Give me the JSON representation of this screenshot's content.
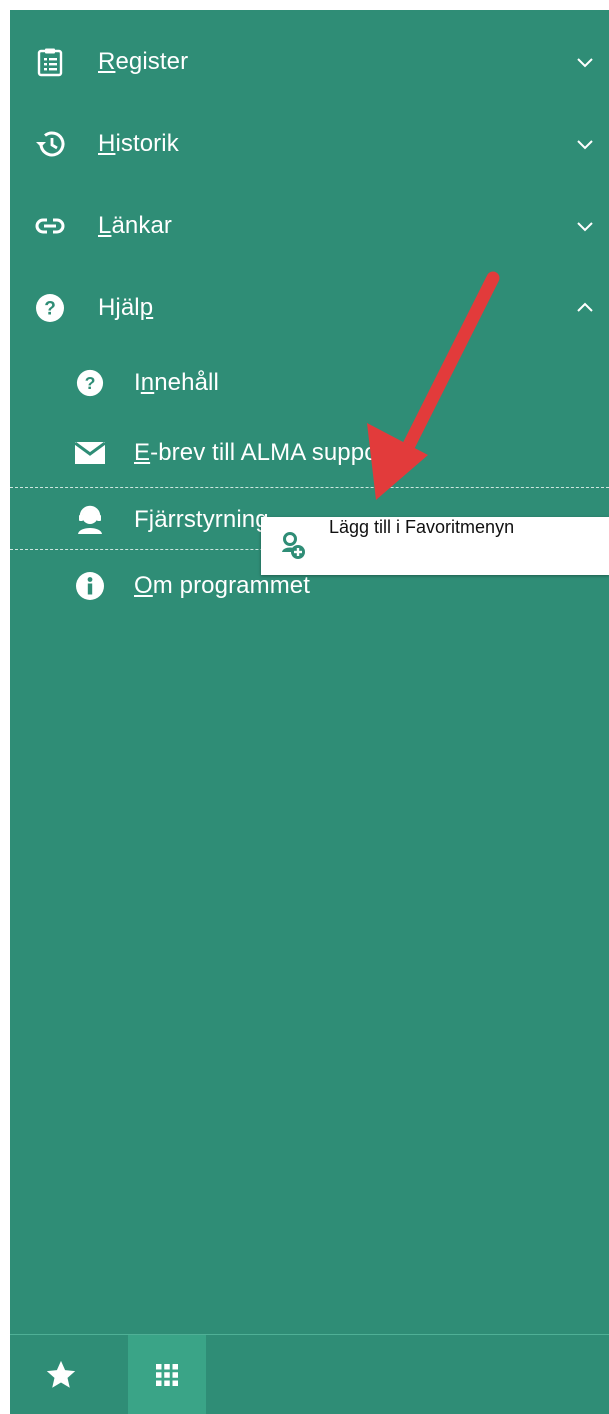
{
  "menu": {
    "sections": [
      {
        "label": "Register",
        "accesskey_index": 0,
        "icon": "clipboard-icon",
        "expanded": false
      },
      {
        "label": "Historik",
        "accesskey_index": 0,
        "icon": "history-icon",
        "expanded": false
      },
      {
        "label": "Länkar",
        "accesskey_index": 0,
        "icon": "link-icon",
        "expanded": false
      },
      {
        "label": "Hjälp",
        "accesskey_index": 4,
        "icon": "help-circle-icon",
        "expanded": true
      }
    ],
    "help_items": [
      {
        "label": "Innehåll",
        "accesskey_index": 1,
        "icon": "help-circle-icon"
      },
      {
        "label": "E-brev till ALMA support",
        "accesskey_index": 0,
        "icon": "envelope-icon"
      },
      {
        "label": "Fjärrstyrning",
        "accesskey_index": -1,
        "icon": "remote-support-icon"
      },
      {
        "label": "Om programmet",
        "accesskey_index": 0,
        "icon": "info-icon"
      }
    ]
  },
  "context_menu": {
    "item_label": "Lägg till i Favoritmenyn",
    "item_icon": "add-favorite-icon"
  },
  "bottom_bar": {
    "favorites_icon": "star-icon",
    "apps_icon": "grid-icon"
  },
  "colors": {
    "panel": "#2f8d76",
    "active_tab": "#3aa487",
    "arrow": "#e23b3b"
  }
}
